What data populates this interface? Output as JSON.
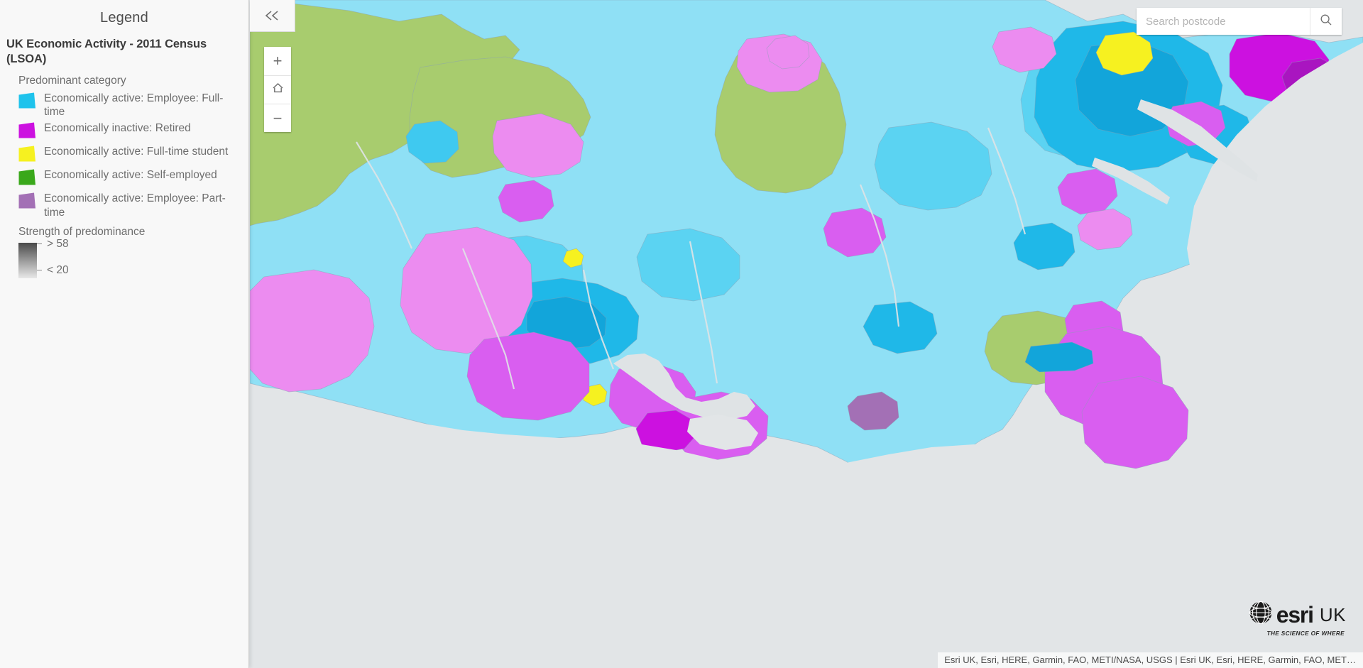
{
  "legend": {
    "panel_title": "Legend",
    "layer_title": "UK Economic Activity - 2011 Census (LSOA)",
    "category_heading": "Predominant category",
    "categories": [
      {
        "label": "Economically active: Employee: Full-time",
        "color": "#1fc3ec"
      },
      {
        "label": "Economically inactive: Retired",
        "color": "#cc11e0"
      },
      {
        "label": "Economically active: Full-time student",
        "color": "#f6f120"
      },
      {
        "label": "Economically active: Self-employed",
        "color": "#3aa81b"
      },
      {
        "label": "Economically active: Employee: Part-time",
        "color": "#a370b5"
      }
    ],
    "strength_heading": "Strength of predominance",
    "ramp": {
      "high_label": "> 58",
      "low_label": "< 20",
      "high_color": "#4a4a4a",
      "low_color": "#e8e8e8"
    },
    "collapse_icon": "chevron-double-left-icon"
  },
  "map_controls": {
    "zoom_in_label": "+",
    "home_icon": "home-icon",
    "zoom_out_label": "−"
  },
  "search": {
    "placeholder": "Search postcode",
    "value": "",
    "icon": "search-icon"
  },
  "branding": {
    "name": "esri",
    "region": "UK",
    "tagline": "THE SCIENCE OF WHERE",
    "globe_icon": "globe-icon"
  },
  "attribution": {
    "text": "Esri UK, Esri, HERE, Garmin, FAO, METI/NASA, USGS | Esri UK, Esri, HERE, Garmin, FAO, MET…"
  },
  "map_style": {
    "sea_color": "#e2e5e7",
    "boundary_color": "#7b8d9e",
    "river_color": "#dfe3e5",
    "fulltime_light": "#8fe0f5",
    "fulltime_mid": "#5bd3f2",
    "fulltime_dark": "#1fb8e8",
    "fulltime_deep": "#12a5da",
    "retired_light": "#ec8cf0",
    "retired_mid": "#d95ef0",
    "retired_dark": "#c22ee0",
    "student": "#f6f120",
    "selfemployed": "#a8cc6e",
    "parttime": "#a370b5"
  }
}
